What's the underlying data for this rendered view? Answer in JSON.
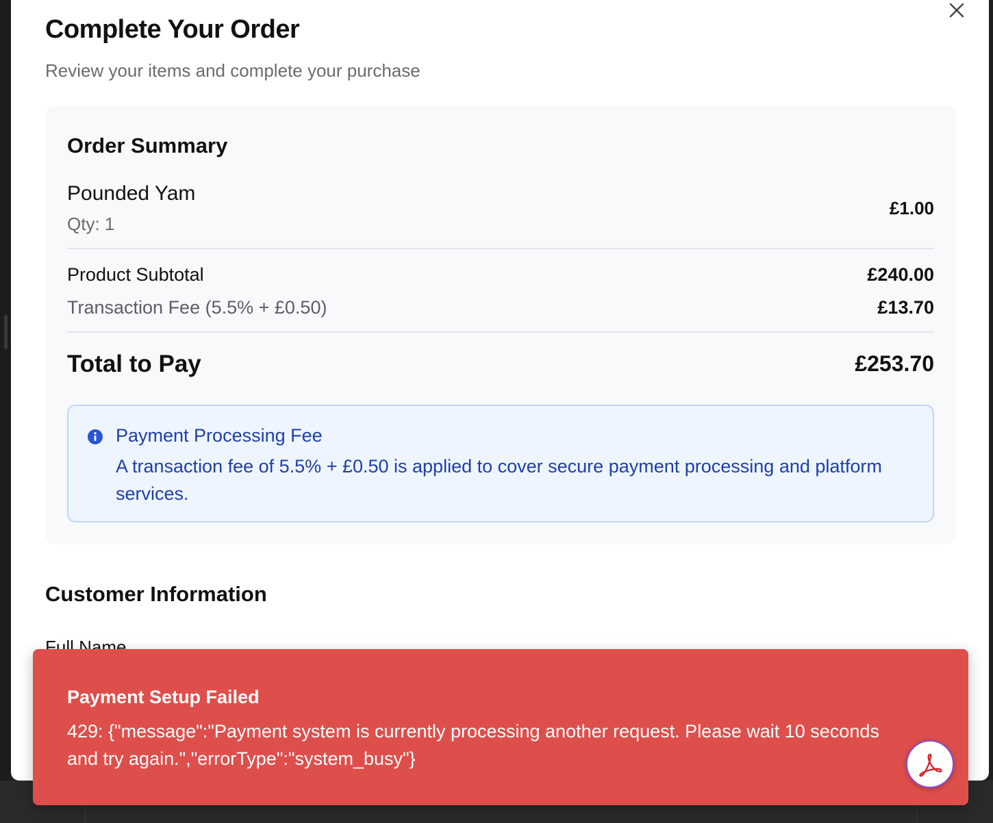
{
  "modal": {
    "title": "Complete Your Order",
    "subtitle": "Review your items and complete your purchase"
  },
  "order_summary": {
    "title": "Order Summary",
    "item": {
      "name": "Pounded Yam",
      "qty": "Qty: 1",
      "price": "£1.00"
    },
    "subtotal_label": "Product Subtotal",
    "subtotal_value": "£240.00",
    "fee_label": "Transaction Fee (5.5% + £0.50)",
    "fee_value": "£13.70",
    "total_label": "Total to Pay",
    "total_value": "£253.70"
  },
  "info_notice": {
    "title": "Payment Processing Fee",
    "text": "A transaction fee of 5.5% + £0.50 is applied to cover secure payment processing and platform services."
  },
  "customer_info": {
    "title": "Customer Information",
    "full_name_label": "Full Name"
  },
  "toast": {
    "title": "Payment Setup Failed",
    "message": "429: {\"message\":\"Payment system is currently processing another request. Please wait 10 seconds and try again.\",\"errorType\":\"system_busy\"}"
  },
  "icons": {
    "close": "close-icon",
    "info": "info-icon",
    "pdf": "pdf-icon"
  },
  "colors": {
    "toast_bg": "#de4f4c",
    "info_text": "#1e3fa8",
    "info_bg": "#eef5fe",
    "info_border": "#bcd6f5"
  }
}
